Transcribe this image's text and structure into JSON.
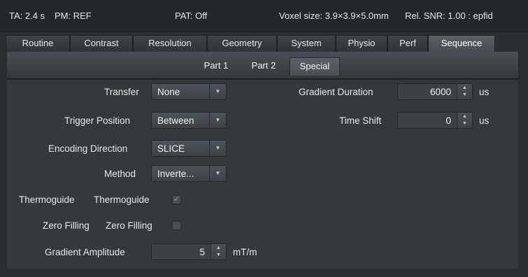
{
  "status": {
    "ta": "TA: 2.4 s",
    "pm": "PM: REF",
    "pat": "PAT: Off",
    "voxel": "Voxel size: 3.9×3.9×5.0mm",
    "snr": "Rel. SNR: 1.00 : epfid"
  },
  "tabs": [
    {
      "label": "Routine"
    },
    {
      "label": "Contrast"
    },
    {
      "label": "Resolution"
    },
    {
      "label": "Geometry"
    },
    {
      "label": "System"
    },
    {
      "label": "Physio"
    },
    {
      "label": "Perf"
    },
    {
      "label": "Sequence",
      "active": true
    }
  ],
  "subtabs": [
    {
      "label": "Part 1"
    },
    {
      "label": "Part 2"
    },
    {
      "label": "Special",
      "active": true
    }
  ],
  "form": {
    "transfer": {
      "label": "Transfer",
      "value": "None"
    },
    "trigger_position": {
      "label": "Trigger Position",
      "value": "Between"
    },
    "encoding_direction": {
      "label": "Encoding Direction",
      "value": "SLICE"
    },
    "method": {
      "label": "Method",
      "value": "Inverte..."
    },
    "thermoguide": {
      "label": "Thermoguide",
      "label2": "Thermoguide",
      "checked": true
    },
    "zero_filling": {
      "label": "Zero Filling",
      "label2": "Zero Filling",
      "checked": false
    },
    "gradient_amplitude": {
      "label": "Gradient Amplitude",
      "value": "5",
      "unit": "mT/m"
    },
    "gradient_duration": {
      "label": "Gradient Duration",
      "value": "6000",
      "unit": "us"
    },
    "time_shift": {
      "label": "Time Shift",
      "value": "0",
      "unit": "us"
    }
  },
  "icons": {
    "dropdown_arrow": "▼",
    "spin": "▲▼",
    "check": "✓"
  }
}
